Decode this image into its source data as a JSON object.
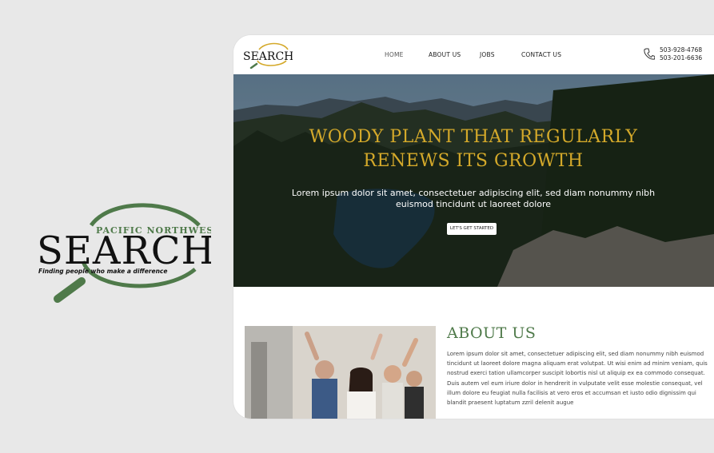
{
  "brand": {
    "region": "PACIFIC NORTHWEST",
    "name": "SEARCH",
    "tagline": "Finding people who make a difference"
  },
  "nav": {
    "items": [
      "HOME",
      "ABOUT US",
      "JOBS",
      "CONTACT US"
    ],
    "phones": [
      "503-928-4768",
      "503-201-6636"
    ]
  },
  "hero": {
    "headline_line1": "WOODY PLANT THAT REGULARLY",
    "headline_line2": "RENEWS ITS GROWTH",
    "subtext": "Lorem ipsum dolor sit amet, consectetuer adipiscing elit, sed diam nonummy nibh euismod tincidunt ut laoreet dolore",
    "cta": "LET'S GET STARTED"
  },
  "about": {
    "title": "ABOUT US",
    "body": "Lorem ipsum dolor sit amet, consectetuer adipiscing elit, sed diam nonummy nibh euismod tincidunt ut laoreet dolore magna aliquam erat volutpat. Ut wisi enim ad minim veniam, quis nostrud exerci tation ullamcorper suscipit lobortis nisl ut aliquip ex ea commodo consequat. Duis autem vel eum iriure dolor in hendrerit in vulputate velit esse molestie consequat, vel illum dolore eu feugiat nulla facilisis at vero eros et accumsan et iusto odio dignissim qui blandit praesent luptatum zzril delenit augue"
  },
  "colors": {
    "brand_green": "#4f7a4a",
    "accent_gold": "#d4a92a",
    "background": "#e8e8e8"
  }
}
